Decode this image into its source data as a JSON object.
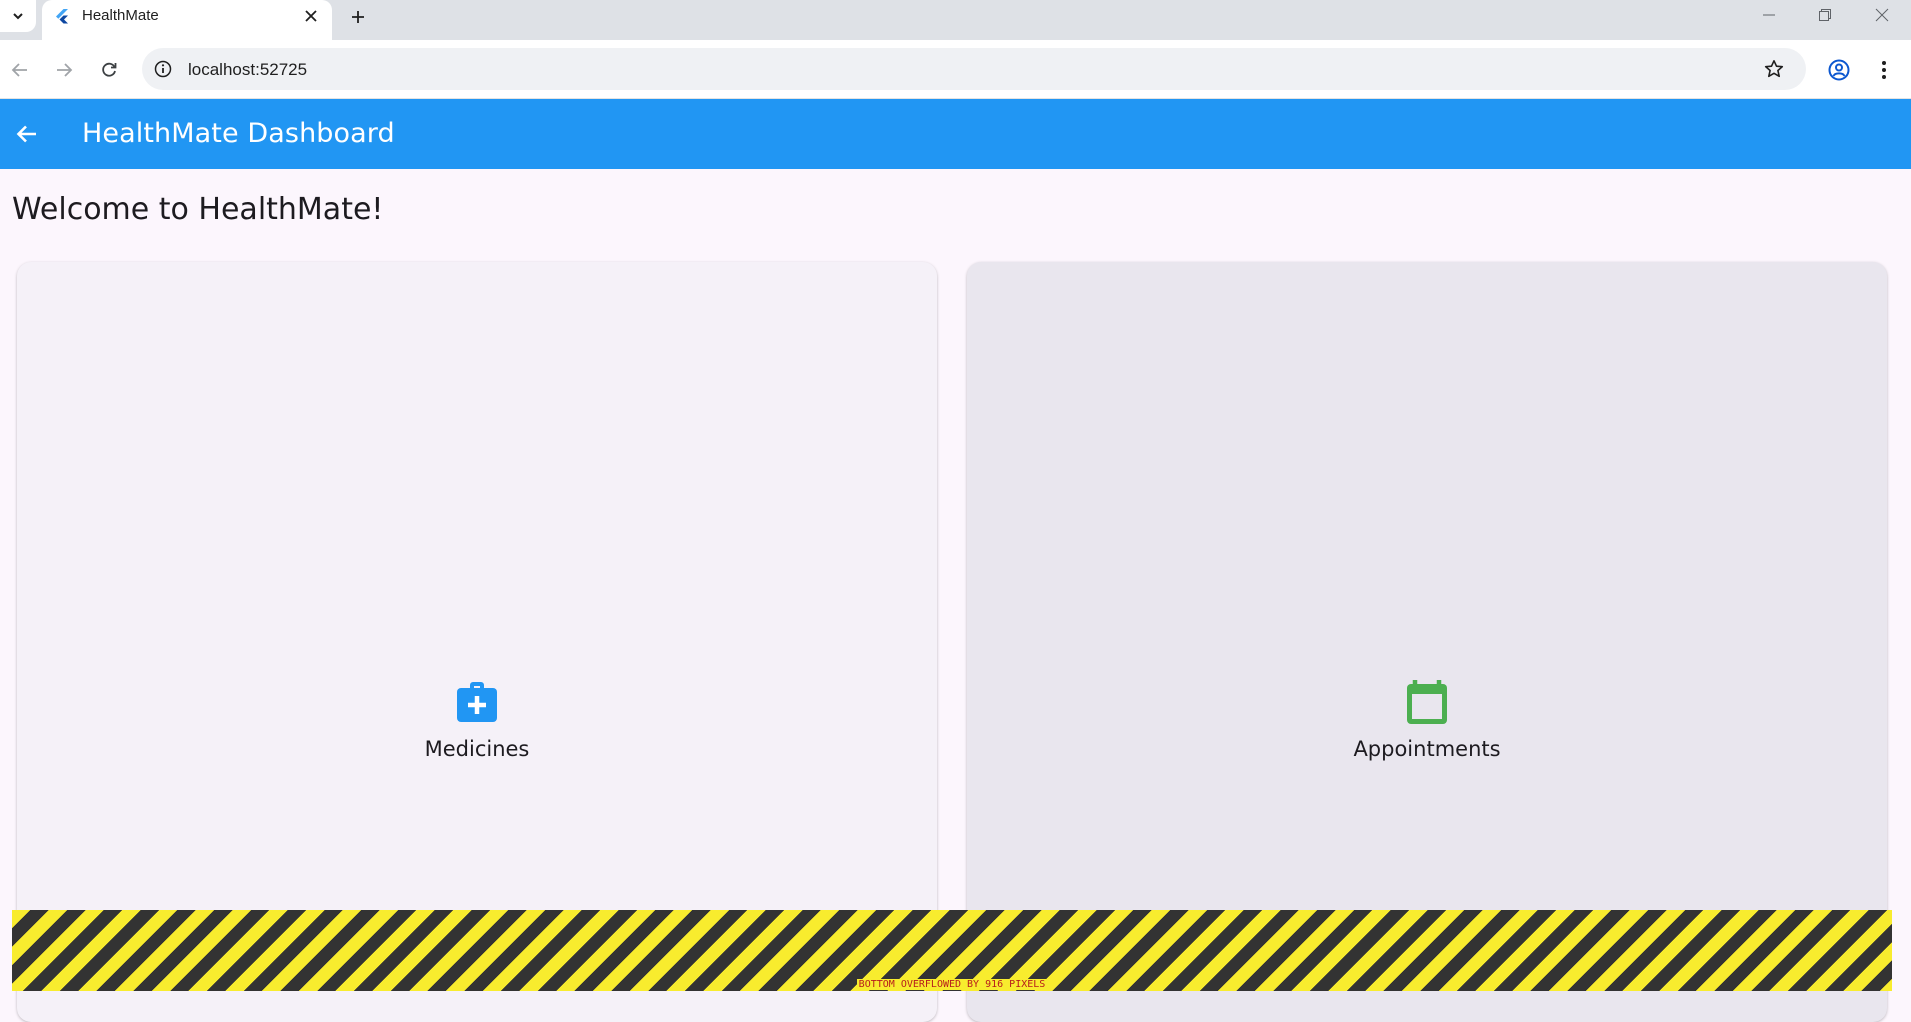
{
  "browser": {
    "tab_title": "HealthMate",
    "url": "localhost:52725"
  },
  "app": {
    "appbar_title": "HealthMate Dashboard",
    "welcome": "Welcome to HealthMate!",
    "cards": [
      {
        "label": "Medicines",
        "icon": "medical-bag-icon",
        "color": "#2196f3"
      },
      {
        "label": "Appointments",
        "icon": "calendar-icon",
        "color": "#4caf50"
      }
    ],
    "overflow_message": "BOTTOM OVERFLOWED BY 916 PIXELS"
  },
  "colors": {
    "appbar": "#2196f3",
    "medicines_accent": "#2196f3",
    "appointments_accent": "#4caf50"
  }
}
